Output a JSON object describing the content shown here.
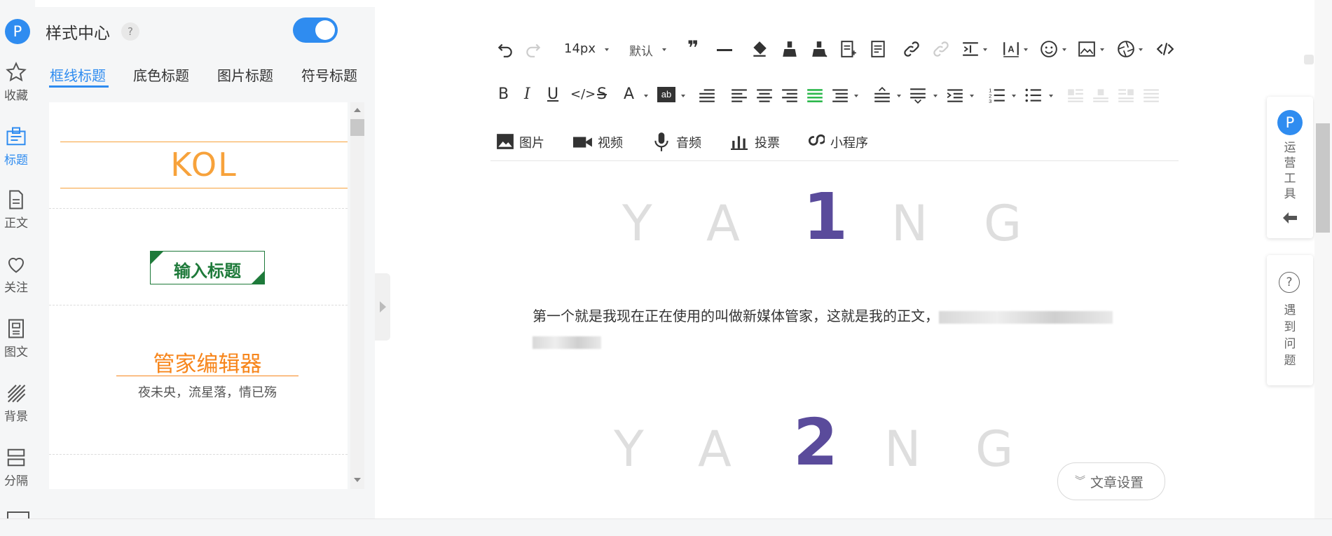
{
  "panel": {
    "logo": "P",
    "title": "样式中心",
    "help": "?",
    "tabs": [
      "框线标题",
      "底色标题",
      "图片标题",
      "符号标题"
    ]
  },
  "rail": [
    {
      "label": "收藏",
      "icon": "star-icon"
    },
    {
      "label": "标题",
      "icon": "title-icon"
    },
    {
      "label": "正文",
      "icon": "document-icon"
    },
    {
      "label": "关注",
      "icon": "heart-icon"
    },
    {
      "label": "图文",
      "icon": "image-text-icon"
    },
    {
      "label": "背景",
      "icon": "background-icon"
    },
    {
      "label": "分隔",
      "icon": "divider-icon"
    }
  ],
  "templates": {
    "kol": "KOL",
    "input_title": "输入标题",
    "editor_name": "管家编辑器",
    "subtitle": "夜未央，流星落，情已殇"
  },
  "toolbar": {
    "font_size": "14px",
    "font_family": "默认",
    "insert": [
      "图片",
      "视频",
      "音频",
      "投票",
      "小程序"
    ]
  },
  "editor": {
    "yang_letters": [
      "Y",
      "A",
      "N",
      "G"
    ],
    "num1": "1",
    "num2": "2",
    "body_text": "第一个就是我现在正在使用的叫做新媒体管家，这就是我的正文，",
    "article_settings": "文章设置"
  },
  "float": {
    "ops_logo": "P",
    "ops_label": [
      "运",
      "营",
      "工",
      "具"
    ],
    "help_label": [
      "遇",
      "到",
      "问",
      "题"
    ],
    "help_q": "?"
  },
  "colors": {
    "accent": "#2f8cf0",
    "kol_orange": "#f7a23b",
    "green": "#1e7a3a",
    "purple_num": "#5a4b9b"
  }
}
